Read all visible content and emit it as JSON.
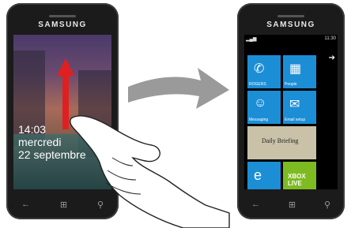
{
  "left_phone": {
    "brand": "SAMSUNG",
    "lockscreen": {
      "time": "14:03",
      "day": "mercredi",
      "date": "22 septembre"
    },
    "nav": {
      "back_icon": "back-arrow-icon",
      "windows_icon": "windows-logo-icon",
      "search_icon": "search-icon"
    }
  },
  "right_phone": {
    "brand": "SAMSUNG",
    "status_time": "11:30",
    "tiles": [
      {
        "label": "ROGERS",
        "icon": "phone-icon",
        "color": "#1b8ed6"
      },
      {
        "label": "People",
        "icon": "people-mosaic-icon",
        "color": "#1b8ed6"
      },
      {
        "label": "Messaging",
        "icon": "messaging-icon",
        "color": "#1b8ed6"
      },
      {
        "label": "Email setup",
        "icon": "email-icon",
        "color": "#1b8ed6"
      },
      {
        "label": "Daily Briefing",
        "icon": "newspaper-icon",
        "color": "#c9c1a8"
      },
      {
        "label": "Internet Explorer",
        "icon": "internet-explorer-icon",
        "color": "#1b8ed6"
      },
      {
        "label": "XBOX LIVE",
        "icon": "xbox-icon",
        "color": "#7dbb21"
      }
    ],
    "nav": {
      "back_icon": "back-arrow-icon",
      "windows_icon": "windows-logo-icon",
      "search_icon": "search-icon"
    }
  },
  "overlay": {
    "swipe_arrow_color": "#e02020",
    "transition_arrow_color": "#9a9a9a"
  }
}
